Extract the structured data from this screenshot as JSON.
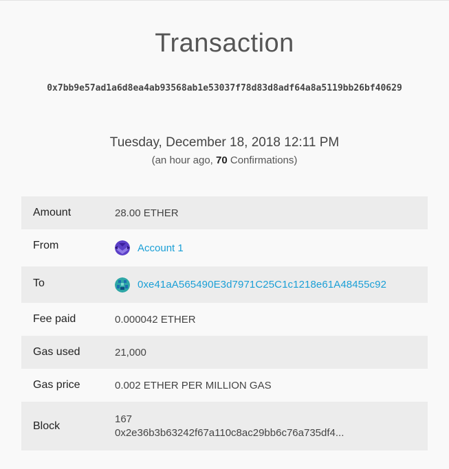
{
  "page": {
    "title": "Transaction",
    "hash": "0x7bb9e57ad1a6d8ea4ab93568ab1e53037f78d83d8adf64a8a5119bb26bf40629",
    "date": "Tuesday, December 18, 2018 12:11 PM",
    "confirm_prefix": "(an hour ago, ",
    "confirm_count": "70",
    "confirm_suffix": " Confirmations)"
  },
  "details": {
    "amount": {
      "label": "Amount",
      "value": "28.00 ETHER"
    },
    "from": {
      "label": "From",
      "value": "Account 1",
      "icon": "account-identicon-icon"
    },
    "to": {
      "label": "To",
      "value": "0xe41aA565490E3d7971C25C1c1218e61A48455c92",
      "icon": "address-identicon-icon"
    },
    "fee": {
      "label": "Fee paid",
      "value": "0.000042 ETHER"
    },
    "gas_used": {
      "label": "Gas used",
      "value": "21,000"
    },
    "gas_price": {
      "label": "Gas price",
      "value": "0.002 ETHER PER MILLION GAS"
    },
    "block": {
      "label": "Block",
      "number": "167",
      "hash": "0x2e36b3b63242f67a110c8ac29bb6c76a735df4..."
    }
  },
  "colors": {
    "link": "#1a9fd6",
    "row_shade": "#ececec",
    "background": "#f9f9f9"
  }
}
